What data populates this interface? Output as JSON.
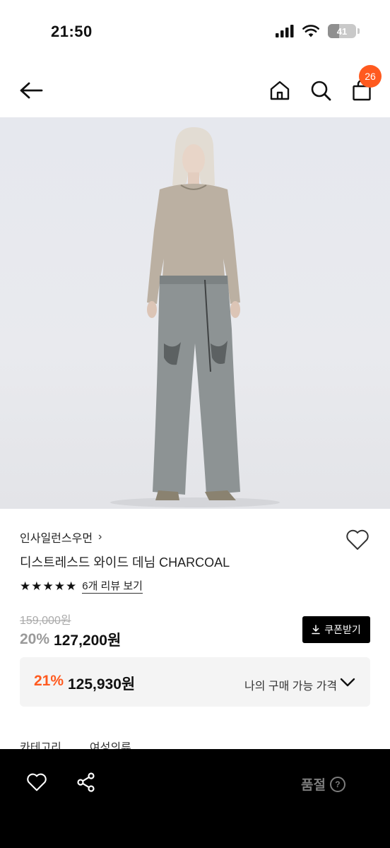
{
  "status_bar": {
    "time": "21:50",
    "battery": "41",
    "battery_level": 0.41
  },
  "nav": {
    "cart_count": "26"
  },
  "product": {
    "brand": "인사일런스우먼",
    "brand_chevron": "›",
    "title": "디스트레스드 와이드 데님 CHARCOAL",
    "stars": [
      "★",
      "★",
      "★",
      "★",
      "★"
    ],
    "review_link": "6개 리뷰 보기",
    "original_price": "159,000원",
    "discount_pct": "20%",
    "sale_price": "127,200원",
    "coupon_button": "쿠폰받기"
  },
  "my_price": {
    "pct": "21%",
    "amount": "125,930원",
    "label": "나의 구매 가능 가격"
  },
  "details": {
    "category_label": "카테고리",
    "category_value": "여성의류"
  },
  "bottom_bar": {
    "status": "품절",
    "help_glyph": "?"
  },
  "colors": {
    "accent": "#ff5a1f",
    "bottom_bar": "#000000"
  },
  "icons": [
    "back-arrow-icon",
    "home-icon",
    "search-icon",
    "shopping-bag-icon",
    "heart-icon",
    "chevron-down-icon",
    "download-icon",
    "share-icon",
    "question-circle-icon",
    "signal-icon",
    "wifi-icon",
    "battery-icon"
  ]
}
